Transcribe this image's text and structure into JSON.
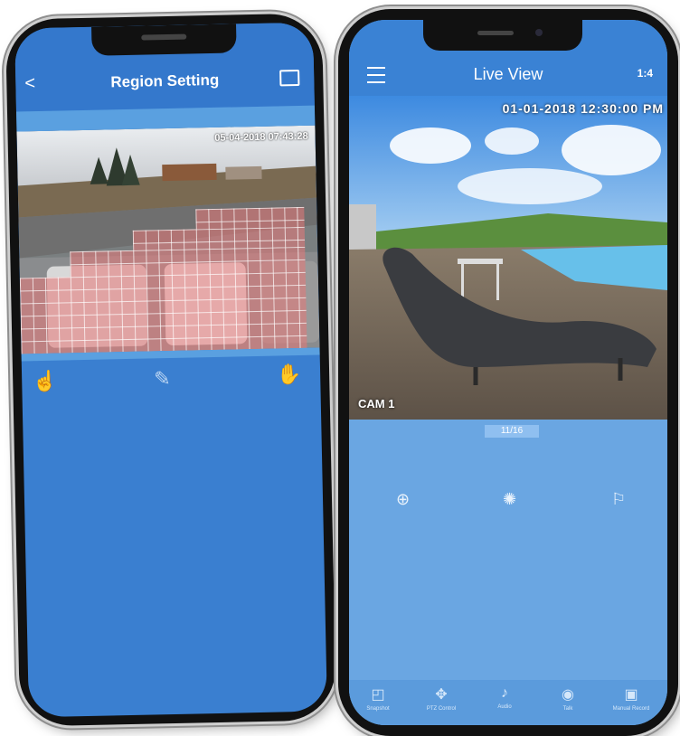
{
  "left_phone": {
    "title": "Region Setting",
    "back_glyph": "<",
    "timestamp": "05-04-2018 07:43:28",
    "toolbar_icons": [
      "touch-icon",
      "pen-icon",
      "hand-icon"
    ]
  },
  "right_phone": {
    "title": "Live View",
    "screens_glyph": "1:4",
    "timestamp": "01-01-2018 12:30:00 PM",
    "camera_label": "CAM 1",
    "page_indicator": "11/16",
    "controls": [
      "zoom-in-icon",
      "settings-icon",
      "flag-icon"
    ],
    "bottom_nav": [
      {
        "icon": "snapshot-icon",
        "label": "Snapshot"
      },
      {
        "icon": "ptz-icon",
        "label": "PTZ Control"
      },
      {
        "icon": "audio-icon",
        "label": "Audio"
      },
      {
        "icon": "talk-icon",
        "label": "Talk"
      },
      {
        "icon": "record-icon",
        "label": "Manual Record"
      }
    ]
  },
  "colors": {
    "header_blue": "#3478cc",
    "screen_blue": "#3a7fd0",
    "light_blue": "#6aa6e2",
    "grid_red": "#e87878"
  }
}
